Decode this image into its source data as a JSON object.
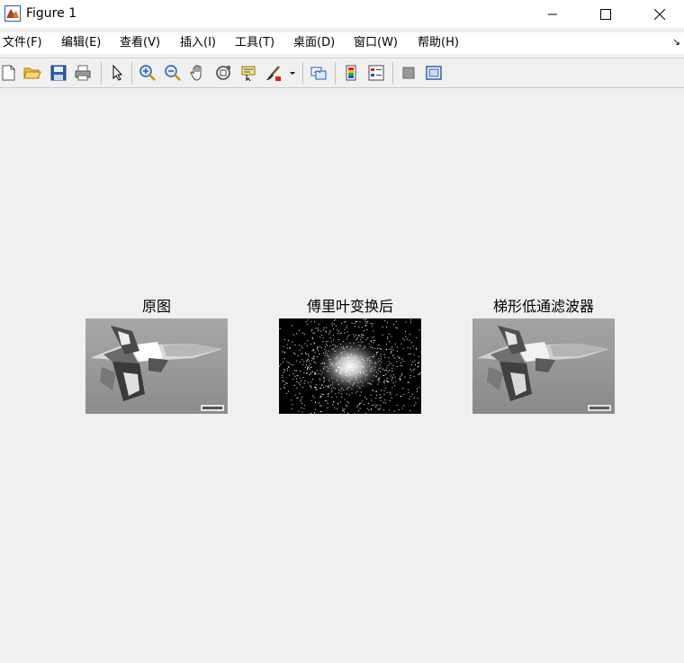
{
  "window": {
    "title": "Figure 1"
  },
  "menu": {
    "items": [
      {
        "label": "文件(F)"
      },
      {
        "label": "编辑(E)"
      },
      {
        "label": "查看(V)"
      },
      {
        "label": "插入(I)"
      },
      {
        "label": "工具(T)"
      },
      {
        "label": "桌面(D)"
      },
      {
        "label": "窗口(W)"
      },
      {
        "label": "帮助(H)"
      }
    ]
  },
  "toolbar": {
    "buttons": [
      "new-figure-icon",
      "open-file-icon",
      "save-icon",
      "print-icon",
      "select-arrow-icon",
      "zoom-in-icon",
      "zoom-out-icon",
      "pan-hand-icon",
      "rotate-3d-icon",
      "data-cursor-icon",
      "brush-icon",
      "brush-dropdown-icon",
      "link-plot-icon",
      "insert-colorbar-icon",
      "insert-legend-icon",
      "hide-plot-tools-icon",
      "show-plot-tools-icon"
    ]
  },
  "figure": {
    "panels": [
      {
        "title": "原图",
        "kind": "aircraft-grayscale"
      },
      {
        "title": "傅里叶变换后",
        "kind": "fourier-spectrum"
      },
      {
        "title": "梯形低通滤波器",
        "kind": "aircraft-filtered"
      }
    ]
  },
  "colors": {
    "accent": "#e8701a",
    "background": "#f0f0f0",
    "chrome": "#ffffff"
  }
}
